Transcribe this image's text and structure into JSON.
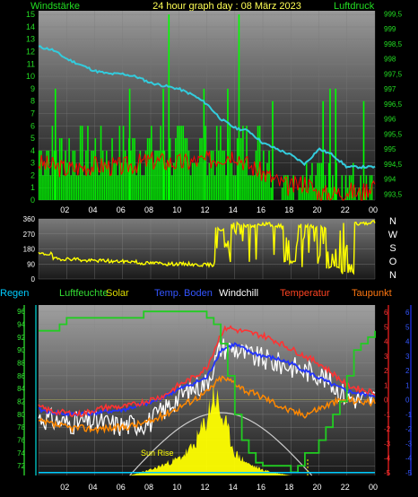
{
  "header": {
    "left_label": "Windstärke",
    "title": "24 hour graph day : 08 März 2023",
    "right_label": "Luftdruck"
  },
  "colors": {
    "wind": "#00ff00",
    "gust": "#ff0000",
    "pressure": "#33ccdd",
    "direction": "#ffff00",
    "regen": "#00ccff",
    "luftfeuchte": "#22cc22",
    "solar": "#ffff00",
    "temp_boden": "#2233ff",
    "windchill": "#ffffff",
    "temperatur": "#ff3333",
    "taupunkt": "#ff8800"
  },
  "legend": [
    {
      "key": "regen",
      "label": "Regen",
      "color": "#00ccff"
    },
    {
      "key": "luftfeuchte",
      "label": "Luftfeuchte",
      "color": "#33dd33"
    },
    {
      "key": "solar",
      "label": "Solar",
      "color": "#dddd00"
    },
    {
      "key": "temp_boden",
      "label": "Temp. Boden",
      "color": "#3355ff"
    },
    {
      "key": "windchill",
      "label": "Windchill",
      "color": "#ffffff"
    },
    {
      "key": "temperatur",
      "label": "Temperatur",
      "color": "#ff4422"
    },
    {
      "key": "taupunkt",
      "label": "Taupunkt",
      "color": "#ff7711"
    }
  ],
  "compass": [
    "N",
    "W",
    "S",
    "O",
    "N"
  ],
  "sun_rise_label": "Sun Rise",
  "chart_data": [
    {
      "type": "line",
      "x_ticks": [
        "02",
        "04",
        "06",
        "08",
        "10",
        "12",
        "14",
        "16",
        "18",
        "20",
        "22",
        "00"
      ],
      "y_left": {
        "label": "Windstärke",
        "ticks": [
          0,
          1,
          2,
          3,
          4,
          5,
          6,
          7,
          8,
          9,
          10,
          11,
          12,
          13,
          14,
          15
        ],
        "range": [
          0,
          15.3
        ]
      },
      "y_right": {
        "label": "Luftdruck",
        "ticks": [
          993.5,
          994,
          994.5,
          995,
          995.5,
          996,
          996.5,
          997,
          997.5,
          998,
          998.5,
          999,
          999.5
        ],
        "range": [
          993.3,
          999.6
        ]
      },
      "series": [
        {
          "key": "pressure",
          "axis": "right",
          "points": [
            [
              0,
              998.4
            ],
            [
              1,
              998.3
            ],
            [
              2,
              998.0
            ],
            [
              3,
              997.8
            ],
            [
              4,
              997.6
            ],
            [
              5,
              997.5
            ],
            [
              6,
              997.5
            ],
            [
              7,
              997.4
            ],
            [
              8,
              997.2
            ],
            [
              9,
              997.1
            ],
            [
              10,
              997.0
            ],
            [
              11,
              996.8
            ],
            [
              12,
              996.5
            ],
            [
              13,
              996.0
            ],
            [
              14,
              995.7
            ],
            [
              15,
              995.6
            ],
            [
              16,
              995.2
            ],
            [
              17,
              995.0
            ],
            [
              18,
              994.8
            ],
            [
              19,
              994.5
            ],
            [
              20,
              995.0
            ],
            [
              21,
              994.8
            ],
            [
              22,
              994.4
            ],
            [
              23,
              994.4
            ],
            [
              24,
              994.4
            ]
          ]
        },
        {
          "key": "wind_peak_spikes",
          "axis": "left",
          "points": [
            [
              9.3,
              15
            ],
            [
              14.3,
              15
            ],
            [
              1.2,
              9
            ],
            [
              6.5,
              9
            ],
            [
              8.9,
              9
            ],
            [
              11.8,
              9
            ],
            [
              13.5,
              9
            ],
            [
              16.7,
              8
            ],
            [
              20.3,
              8
            ],
            [
              20.8,
              9
            ],
            [
              21.2,
              9
            ],
            [
              23.2,
              8
            ]
          ]
        },
        {
          "key": "gust_baseline",
          "axis": "left",
          "points": [
            [
              0,
              3
            ],
            [
              2,
              2.5
            ],
            [
              4,
              2.8
            ],
            [
              6,
              2.7
            ],
            [
              8,
              3.2
            ],
            [
              10,
              3.0
            ],
            [
              12,
              3.2
            ],
            [
              14,
              3.8
            ],
            [
              15,
              2.8
            ],
            [
              16,
              2.2
            ],
            [
              17,
              1.5
            ],
            [
              18,
              1.0
            ],
            [
              19,
              1.5
            ],
            [
              20,
              0.5
            ],
            [
              21,
              0.5
            ],
            [
              22,
              0.8
            ],
            [
              23,
              0.5
            ],
            [
              24,
              1.5
            ]
          ]
        }
      ]
    },
    {
      "type": "line",
      "x_ticks": [
        "02",
        "04",
        "06",
        "08",
        "10",
        "12",
        "14",
        "16",
        "18",
        "20",
        "22",
        "00"
      ],
      "y_left": {
        "ticks": [
          0,
          90,
          180,
          270,
          360
        ],
        "range": [
          0,
          360
        ]
      },
      "series": [
        {
          "key": "direction",
          "points": [
            [
              0,
              150
            ],
            [
              2,
              120
            ],
            [
              4,
              110
            ],
            [
              6,
              105
            ],
            [
              8,
              95
            ],
            [
              10,
              90
            ],
            [
              12,
              85
            ],
            [
              13,
              300
            ],
            [
              14,
              330
            ],
            [
              15,
              320
            ],
            [
              16,
              330
            ],
            [
              17,
              320
            ],
            [
              18,
              100
            ],
            [
              19,
              320
            ],
            [
              20,
              310
            ],
            [
              21,
              70
            ],
            [
              22,
              40
            ],
            [
              23,
              330
            ],
            [
              24,
              340
            ]
          ]
        }
      ]
    },
    {
      "type": "line",
      "x_ticks": [
        "02",
        "04",
        "06",
        "08",
        "10",
        "12",
        "14",
        "16",
        "18",
        "20",
        "22",
        "00"
      ],
      "y_left": {
        "label": "Luftfeuchte",
        "ticks": [
          72,
          74,
          76,
          78,
          80,
          82,
          84,
          86,
          88,
          90,
          92,
          94,
          96
        ],
        "range": [
          70.5,
          97
        ]
      },
      "y_right_temp": {
        "label": "Temperatur",
        "ticks": [
          6,
          5,
          4,
          3,
          2,
          1,
          0,
          -1,
          -2,
          -3,
          -4,
          -5
        ],
        "range": [
          -5.2,
          6.5
        ]
      },
      "y_right_regen": {
        "label": "Regen",
        "ticks": [
          6,
          5,
          4,
          3,
          2,
          1,
          0,
          -1,
          -2,
          -3,
          -4,
          -5
        ],
        "range": [
          -5.2,
          6.5
        ]
      },
      "series": [
        {
          "key": "luftfeuchte",
          "axis": "left",
          "points": [
            [
              0,
              93
            ],
            [
              1.5,
              94
            ],
            [
              2,
              95
            ],
            [
              7,
              95
            ],
            [
              7.5,
              96
            ],
            [
              11.5,
              96
            ],
            [
              12,
              95
            ],
            [
              12.5,
              94
            ],
            [
              13,
              91
            ],
            [
              13.5,
              86
            ],
            [
              14,
              80
            ],
            [
              14.5,
              76
            ],
            [
              15,
              74
            ],
            [
              15.5,
              72.5
            ],
            [
              16,
              72
            ],
            [
              17,
              72
            ],
            [
              18,
              71
            ],
            [
              18.5,
              72
            ],
            [
              19,
              74
            ],
            [
              20,
              76
            ],
            [
              20.5,
              78
            ],
            [
              21,
              80
            ],
            [
              21.5,
              82
            ],
            [
              22,
              86
            ],
            [
              22.5,
              90
            ],
            [
              23,
              91
            ],
            [
              23.5,
              92
            ],
            [
              24,
              93
            ]
          ]
        },
        {
          "key": "solar",
          "axis": "none",
          "points": [
            [
              6.5,
              0
            ],
            [
              8,
              0.05
            ],
            [
              9,
              0.1
            ],
            [
              10,
              0.15
            ],
            [
              11,
              0.25
            ],
            [
              12,
              0.5
            ],
            [
              12.5,
              0.75
            ],
            [
              13,
              0.55
            ],
            [
              13.5,
              0.4
            ],
            [
              14,
              0.2
            ],
            [
              15,
              0.1
            ],
            [
              16,
              0.05
            ],
            [
              17,
              0.02
            ],
            [
              18,
              0
            ]
          ]
        },
        {
          "key": "temperatur",
          "axis": "right",
          "points": [
            [
              0,
              -0.5
            ],
            [
              1,
              -0.8
            ],
            [
              2,
              -0.9
            ],
            [
              3,
              -1.0
            ],
            [
              4,
              -0.7
            ],
            [
              5,
              -0.5
            ],
            [
              6,
              -0.5
            ],
            [
              7,
              -0.3
            ],
            [
              8,
              0.0
            ],
            [
              9,
              0.3
            ],
            [
              10,
              1.0
            ],
            [
              11,
              1.5
            ],
            [
              12,
              2.2
            ],
            [
              13,
              4.5
            ],
            [
              13.5,
              5.0
            ],
            [
              14,
              4.8
            ],
            [
              15,
              4.6
            ],
            [
              16,
              4.4
            ],
            [
              17,
              4.0
            ],
            [
              18,
              3.5
            ],
            [
              19,
              3.0
            ],
            [
              20,
              2.5
            ],
            [
              21,
              1.8
            ],
            [
              22,
              1.0
            ],
            [
              23,
              0.7
            ],
            [
              24,
              0.5
            ]
          ]
        },
        {
          "key": "temp_boden",
          "axis": "right",
          "points": [
            [
              0,
              -0.7
            ],
            [
              2,
              -1.0
            ],
            [
              4,
              -0.9
            ],
            [
              6,
              -0.7
            ],
            [
              8,
              -0.2
            ],
            [
              10,
              0.7
            ],
            [
              12,
              1.5
            ],
            [
              13,
              3.4
            ],
            [
              14,
              3.8
            ],
            [
              15,
              3.3
            ],
            [
              16,
              3.0
            ],
            [
              17,
              2.8
            ],
            [
              18,
              2.5
            ],
            [
              19,
              2.0
            ],
            [
              20,
              1.5
            ],
            [
              21,
              1.0
            ],
            [
              22,
              0.6
            ],
            [
              23,
              0.4
            ],
            [
              24,
              0.3
            ]
          ]
        },
        {
          "key": "taupunkt",
          "axis": "right",
          "points": [
            [
              0,
              -1.5
            ],
            [
              2,
              -1.9
            ],
            [
              4,
              -2.0
            ],
            [
              6,
              -1.9
            ],
            [
              8,
              -1.5
            ],
            [
              10,
              -0.5
            ],
            [
              11,
              0.0
            ],
            [
              12,
              0.5
            ],
            [
              13,
              1.5
            ],
            [
              14,
              1.2
            ],
            [
              15,
              0.5
            ],
            [
              16,
              0.2
            ],
            [
              17,
              -0.3
            ],
            [
              18,
              -0.8
            ],
            [
              19,
              -1.0
            ],
            [
              20,
              -0.6
            ],
            [
              21,
              -0.2
            ],
            [
              22,
              0.0
            ],
            [
              23,
              -0.1
            ],
            [
              24,
              -0.2
            ]
          ]
        },
        {
          "key": "windchill",
          "axis": "right",
          "points": [
            [
              0,
              -1.2
            ],
            [
              2,
              -1.6
            ],
            [
              4,
              -1.5
            ],
            [
              6,
              -1.8
            ],
            [
              8,
              -1.5
            ],
            [
              10,
              0.2
            ],
            [
              11,
              0.8
            ],
            [
              12,
              1.2
            ],
            [
              13,
              3.6
            ],
            [
              14,
              3.5
            ],
            [
              15,
              3.0
            ],
            [
              16,
              2.8
            ],
            [
              17,
              2.5
            ],
            [
              18,
              2.3
            ],
            [
              19,
              2.0
            ],
            [
              20,
              1.8
            ],
            [
              21,
              1.0
            ],
            [
              22,
              0.2
            ],
            [
              23,
              0.0
            ],
            [
              24,
              0.1
            ]
          ]
        },
        {
          "key": "regen",
          "axis": "right",
          "points": [
            [
              0,
              -5
            ],
            [
              24,
              -5
            ]
          ]
        }
      ]
    }
  ]
}
